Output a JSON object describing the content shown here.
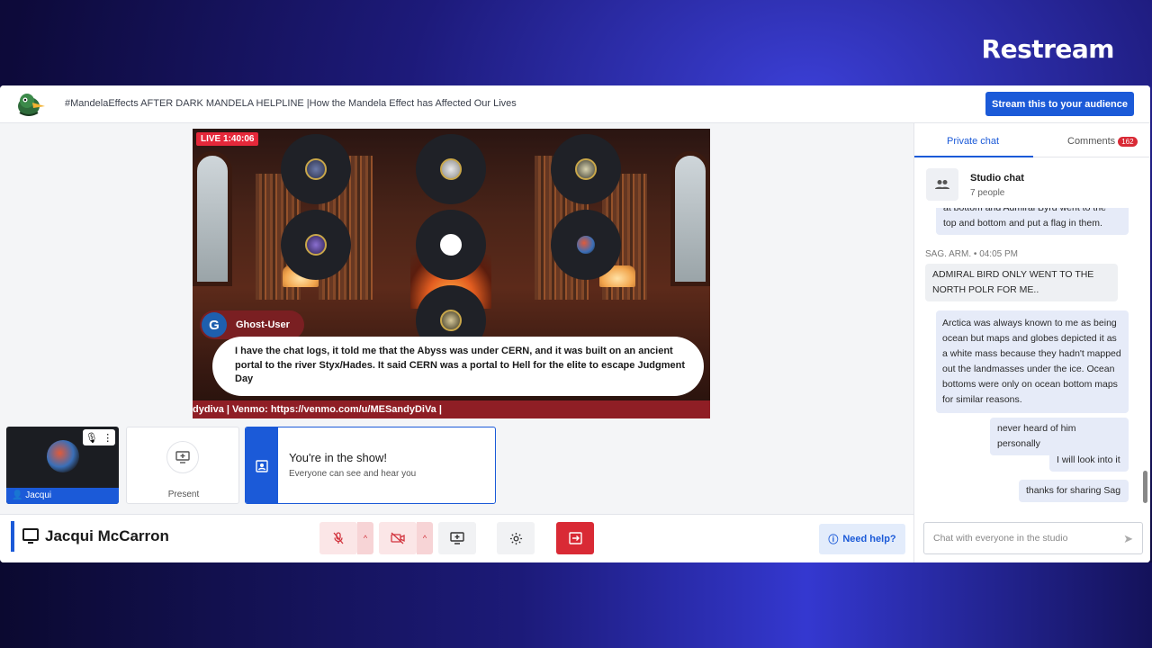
{
  "brand": "Restream",
  "header": {
    "title": "#MandelaEffects AFTER DARK MANDELA HELPLINE |How the Mandela Effect has Affected Our Lives",
    "stream_button": "Stream this to your audience"
  },
  "stage": {
    "live_label": "LIVE 1:40:06",
    "comment_author": "Ghost-User",
    "comment_avatar_letter": "G",
    "comment_text": "I have the chat logs, it told me that the Abyss was under CERN, and it was built on an ancient portal to the river Styx/Hades. It said CERN was a portal to Hell for the elite to escape Judgment Day",
    "ticker_text": "dydiva | Venmo: https://venmo.com/u/MESandyDiVa |"
  },
  "tiles": {
    "self_name": "Jacqui",
    "present_label": "Present",
    "show_title": "You're in the show!",
    "show_subtitle": "Everyone can see and hear you"
  },
  "bottombar": {
    "user_name": "Jacqui McCarron",
    "help_label": "Need help?"
  },
  "chat": {
    "tab_private": "Private chat",
    "tab_comments": "Comments",
    "comments_count": "162",
    "studio_title": "Studio chat",
    "studio_people": "7 people",
    "partial_message": "at bottom and Admiral Byrd went to the top and bottom and put a flag in them.",
    "author": "SAG. ARM.",
    "time": "04:05 PM",
    "sag_message": "ADMIRAL BIRD ONLY WENT TO THE NORTH POLR FOR ME..",
    "mine_messages": [
      "Arctica was always known to me as being ocean but maps and globes depicted it as a white mass because they hadn't mapped out the landmasses under the ice. Ocean bottoms were only on ocean bottom maps for similar reasons.",
      "never heard of him personally",
      "I will look into it",
      "thanks for sharing Sag"
    ],
    "input_placeholder": "Chat with everyone in the studio"
  },
  "colors": {
    "accent": "#1b5ad8",
    "live_red": "#e5283a",
    "leave_red": "#d92a35",
    "ticker": "#8f1e25"
  }
}
